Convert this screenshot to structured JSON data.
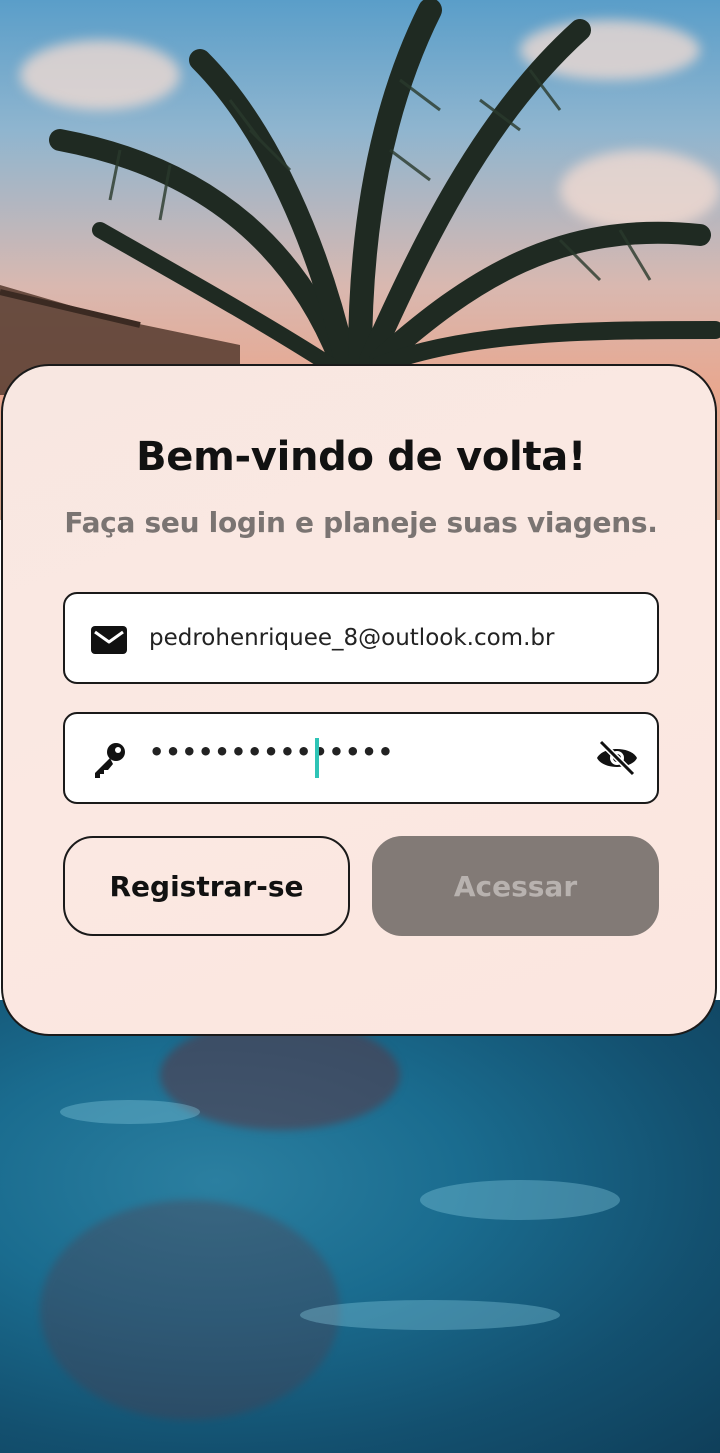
{
  "login": {
    "title": "Bem-vindo de volta!",
    "subtitle": "Faça seu login e planeje suas viagens.",
    "email_value": "pedrohenriquee_8@outlook.com.br",
    "password_value": "•••••••••••••••",
    "register_label": "Registrar-se",
    "access_label": "Acessar"
  },
  "icons": {
    "email": "envelope-icon",
    "password": "key-icon",
    "visibility": "eye-off-icon"
  },
  "colors": {
    "card_background": "#fbe8e2",
    "access_button_disabled": "#827a76",
    "caret": "#2ec4b6"
  }
}
